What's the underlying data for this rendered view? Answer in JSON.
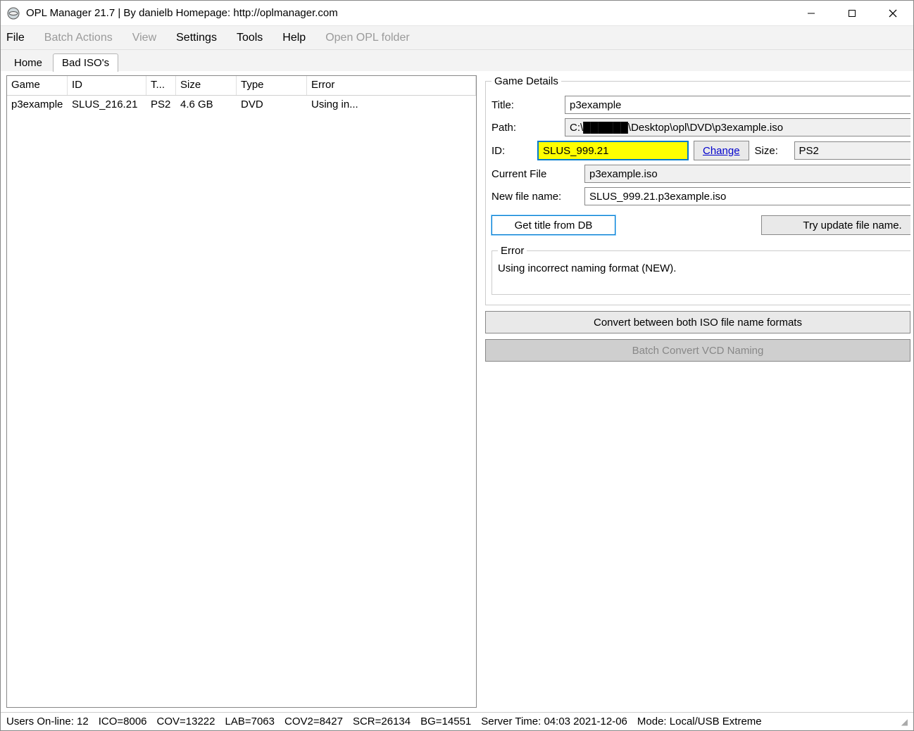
{
  "window": {
    "title": "OPL Manager 21.7 | By danielb Homepage: http://oplmanager.com"
  },
  "menu": {
    "file": "File",
    "batch_actions": "Batch Actions",
    "view": "View",
    "settings": "Settings",
    "tools": "Tools",
    "help": "Help",
    "open_opl_folder": "Open OPL folder"
  },
  "tabs": {
    "home": "Home",
    "bad_isos": "Bad ISO's"
  },
  "list": {
    "headers": {
      "game": "Game",
      "id": "ID",
      "t": "T...",
      "size": "Size",
      "type": "Type",
      "error": "Error"
    },
    "rows": [
      {
        "game": "p3example",
        "id": "SLUS_216.21",
        "t": "PS2",
        "size": "4.6 GB",
        "type": "DVD",
        "error": "Using in..."
      }
    ]
  },
  "details": {
    "legend": "Game Details",
    "title_label": "Title:",
    "title_value": "p3example",
    "path_label": "Path:",
    "path_value": "C:\\██████\\Desktop\\opl\\DVD\\p3example.iso",
    "id_label": "ID:",
    "id_value": "SLUS_999.21",
    "change_label": "Change",
    "size_label": "Size:",
    "size_value": "PS2",
    "current_file_label": "Current File",
    "current_file_value": "p3example.iso",
    "new_file_label": "New file name:",
    "new_file_value": "SLUS_999.21.p3example.iso",
    "get_title_btn": "Get title from DB",
    "try_update_btn": "Try update file name.",
    "error_legend": "Error",
    "error_text": "Using incorrect naming format (NEW)."
  },
  "actions": {
    "convert_formats": "Convert between both ISO file name formats",
    "batch_convert": "Batch Convert VCD Naming"
  },
  "status": {
    "users": "Users On-line: 12",
    "ico": "ICO=8006",
    "cov": "COV=13222",
    "lab": "LAB=7063",
    "cov2": "COV2=8427",
    "scr": "SCR=26134",
    "bg": "BG=14551",
    "server_time": "Server Time: 04:03 2021-12-06",
    "mode": "Mode: Local/USB Extreme"
  }
}
